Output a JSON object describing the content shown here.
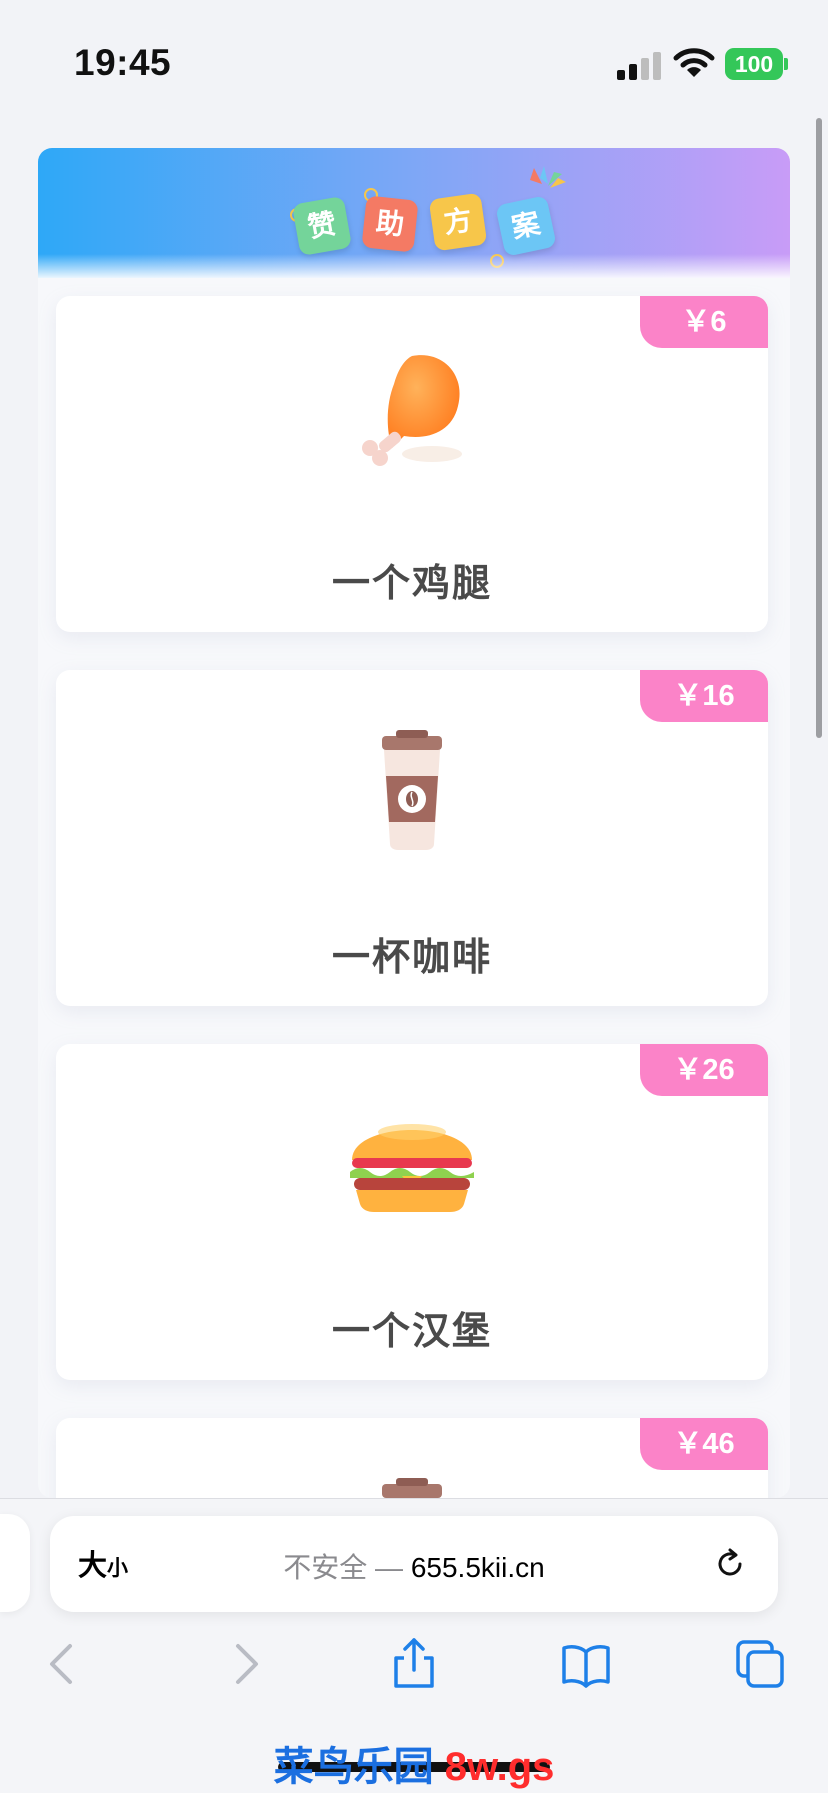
{
  "status": {
    "time": "19:45",
    "battery": "100"
  },
  "banner": {
    "tiles": [
      "赞",
      "助",
      "方",
      "案"
    ]
  },
  "items": [
    {
      "price": "￥6",
      "label": "一个鸡腿",
      "icon": "chicken-leg-icon"
    },
    {
      "price": "￥16",
      "label": "一杯咖啡",
      "icon": "coffee-cup-icon"
    },
    {
      "price": "￥26",
      "label": "一个汉堡",
      "icon": "hamburger-icon"
    },
    {
      "price": "￥46",
      "label": "",
      "icon": "coffee-cup-icon"
    }
  ],
  "browser": {
    "text_size_big": "大",
    "text_size_small": "小",
    "insecure_label": "不安全 —",
    "url": "655.5kii.cn",
    "icons": [
      "back-icon",
      "forward-icon",
      "share-icon",
      "bookmarks-icon",
      "tabs-icon",
      "reload-icon"
    ]
  },
  "watermark": {
    "part1": "菜鸟乐园",
    "part2": "8w.gs"
  },
  "colors": {
    "price_tag": "#fb83c8",
    "banner_start": "#2ea8f7",
    "banner_end": "#c89cf7",
    "battery": "#34c759",
    "accent": "#007aff"
  }
}
